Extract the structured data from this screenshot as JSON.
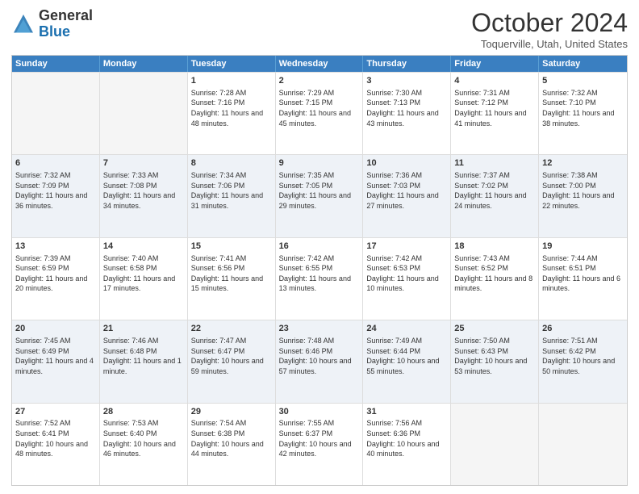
{
  "header": {
    "logo_general": "General",
    "logo_blue": "Blue",
    "title": "October 2024",
    "subtitle": "Toquerville, Utah, United States"
  },
  "days": [
    "Sunday",
    "Monday",
    "Tuesday",
    "Wednesday",
    "Thursday",
    "Friday",
    "Saturday"
  ],
  "weeks": [
    [
      {
        "day": "",
        "sunrise": "",
        "sunset": "",
        "daylight": "",
        "empty": true
      },
      {
        "day": "",
        "sunrise": "",
        "sunset": "",
        "daylight": "",
        "empty": true
      },
      {
        "day": "1",
        "sunrise": "Sunrise: 7:28 AM",
        "sunset": "Sunset: 7:16 PM",
        "daylight": "Daylight: 11 hours and 48 minutes.",
        "empty": false
      },
      {
        "day": "2",
        "sunrise": "Sunrise: 7:29 AM",
        "sunset": "Sunset: 7:15 PM",
        "daylight": "Daylight: 11 hours and 45 minutes.",
        "empty": false
      },
      {
        "day": "3",
        "sunrise": "Sunrise: 7:30 AM",
        "sunset": "Sunset: 7:13 PM",
        "daylight": "Daylight: 11 hours and 43 minutes.",
        "empty": false
      },
      {
        "day": "4",
        "sunrise": "Sunrise: 7:31 AM",
        "sunset": "Sunset: 7:12 PM",
        "daylight": "Daylight: 11 hours and 41 minutes.",
        "empty": false
      },
      {
        "day": "5",
        "sunrise": "Sunrise: 7:32 AM",
        "sunset": "Sunset: 7:10 PM",
        "daylight": "Daylight: 11 hours and 38 minutes.",
        "empty": false
      }
    ],
    [
      {
        "day": "6",
        "sunrise": "Sunrise: 7:32 AM",
        "sunset": "Sunset: 7:09 PM",
        "daylight": "Daylight: 11 hours and 36 minutes.",
        "empty": false
      },
      {
        "day": "7",
        "sunrise": "Sunrise: 7:33 AM",
        "sunset": "Sunset: 7:08 PM",
        "daylight": "Daylight: 11 hours and 34 minutes.",
        "empty": false
      },
      {
        "day": "8",
        "sunrise": "Sunrise: 7:34 AM",
        "sunset": "Sunset: 7:06 PM",
        "daylight": "Daylight: 11 hours and 31 minutes.",
        "empty": false
      },
      {
        "day": "9",
        "sunrise": "Sunrise: 7:35 AM",
        "sunset": "Sunset: 7:05 PM",
        "daylight": "Daylight: 11 hours and 29 minutes.",
        "empty": false
      },
      {
        "day": "10",
        "sunrise": "Sunrise: 7:36 AM",
        "sunset": "Sunset: 7:03 PM",
        "daylight": "Daylight: 11 hours and 27 minutes.",
        "empty": false
      },
      {
        "day": "11",
        "sunrise": "Sunrise: 7:37 AM",
        "sunset": "Sunset: 7:02 PM",
        "daylight": "Daylight: 11 hours and 24 minutes.",
        "empty": false
      },
      {
        "day": "12",
        "sunrise": "Sunrise: 7:38 AM",
        "sunset": "Sunset: 7:00 PM",
        "daylight": "Daylight: 11 hours and 22 minutes.",
        "empty": false
      }
    ],
    [
      {
        "day": "13",
        "sunrise": "Sunrise: 7:39 AM",
        "sunset": "Sunset: 6:59 PM",
        "daylight": "Daylight: 11 hours and 20 minutes.",
        "empty": false
      },
      {
        "day": "14",
        "sunrise": "Sunrise: 7:40 AM",
        "sunset": "Sunset: 6:58 PM",
        "daylight": "Daylight: 11 hours and 17 minutes.",
        "empty": false
      },
      {
        "day": "15",
        "sunrise": "Sunrise: 7:41 AM",
        "sunset": "Sunset: 6:56 PM",
        "daylight": "Daylight: 11 hours and 15 minutes.",
        "empty": false
      },
      {
        "day": "16",
        "sunrise": "Sunrise: 7:42 AM",
        "sunset": "Sunset: 6:55 PM",
        "daylight": "Daylight: 11 hours and 13 minutes.",
        "empty": false
      },
      {
        "day": "17",
        "sunrise": "Sunrise: 7:42 AM",
        "sunset": "Sunset: 6:53 PM",
        "daylight": "Daylight: 11 hours and 10 minutes.",
        "empty": false
      },
      {
        "day": "18",
        "sunrise": "Sunrise: 7:43 AM",
        "sunset": "Sunset: 6:52 PM",
        "daylight": "Daylight: 11 hours and 8 minutes.",
        "empty": false
      },
      {
        "day": "19",
        "sunrise": "Sunrise: 7:44 AM",
        "sunset": "Sunset: 6:51 PM",
        "daylight": "Daylight: 11 hours and 6 minutes.",
        "empty": false
      }
    ],
    [
      {
        "day": "20",
        "sunrise": "Sunrise: 7:45 AM",
        "sunset": "Sunset: 6:49 PM",
        "daylight": "Daylight: 11 hours and 4 minutes.",
        "empty": false
      },
      {
        "day": "21",
        "sunrise": "Sunrise: 7:46 AM",
        "sunset": "Sunset: 6:48 PM",
        "daylight": "Daylight: 11 hours and 1 minute.",
        "empty": false
      },
      {
        "day": "22",
        "sunrise": "Sunrise: 7:47 AM",
        "sunset": "Sunset: 6:47 PM",
        "daylight": "Daylight: 10 hours and 59 minutes.",
        "empty": false
      },
      {
        "day": "23",
        "sunrise": "Sunrise: 7:48 AM",
        "sunset": "Sunset: 6:46 PM",
        "daylight": "Daylight: 10 hours and 57 minutes.",
        "empty": false
      },
      {
        "day": "24",
        "sunrise": "Sunrise: 7:49 AM",
        "sunset": "Sunset: 6:44 PM",
        "daylight": "Daylight: 10 hours and 55 minutes.",
        "empty": false
      },
      {
        "day": "25",
        "sunrise": "Sunrise: 7:50 AM",
        "sunset": "Sunset: 6:43 PM",
        "daylight": "Daylight: 10 hours and 53 minutes.",
        "empty": false
      },
      {
        "day": "26",
        "sunrise": "Sunrise: 7:51 AM",
        "sunset": "Sunset: 6:42 PM",
        "daylight": "Daylight: 10 hours and 50 minutes.",
        "empty": false
      }
    ],
    [
      {
        "day": "27",
        "sunrise": "Sunrise: 7:52 AM",
        "sunset": "Sunset: 6:41 PM",
        "daylight": "Daylight: 10 hours and 48 minutes.",
        "empty": false
      },
      {
        "day": "28",
        "sunrise": "Sunrise: 7:53 AM",
        "sunset": "Sunset: 6:40 PM",
        "daylight": "Daylight: 10 hours and 46 minutes.",
        "empty": false
      },
      {
        "day": "29",
        "sunrise": "Sunrise: 7:54 AM",
        "sunset": "Sunset: 6:38 PM",
        "daylight": "Daylight: 10 hours and 44 minutes.",
        "empty": false
      },
      {
        "day": "30",
        "sunrise": "Sunrise: 7:55 AM",
        "sunset": "Sunset: 6:37 PM",
        "daylight": "Daylight: 10 hours and 42 minutes.",
        "empty": false
      },
      {
        "day": "31",
        "sunrise": "Sunrise: 7:56 AM",
        "sunset": "Sunset: 6:36 PM",
        "daylight": "Daylight: 10 hours and 40 minutes.",
        "empty": false
      },
      {
        "day": "",
        "sunrise": "",
        "sunset": "",
        "daylight": "",
        "empty": true
      },
      {
        "day": "",
        "sunrise": "",
        "sunset": "",
        "daylight": "",
        "empty": true
      }
    ]
  ]
}
